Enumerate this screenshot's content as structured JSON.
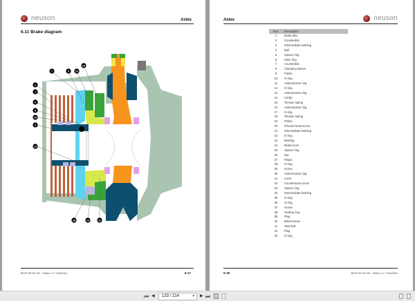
{
  "left_page": {
    "brand": "neuson",
    "header": "Axles",
    "section_title": "6.11   Brake diagram",
    "footer_text": "BETR HB 301 EN – Edition 2.2 * 503a01En",
    "page_number": "6-17",
    "callouts": {
      "top": [
        "7",
        "9",
        "10",
        "16"
      ],
      "left": [
        "2",
        "1",
        "6",
        "5",
        "15",
        "3",
        "14"
      ],
      "bottom": [
        "18",
        "13",
        "11"
      ]
    }
  },
  "right_page": {
    "brand": "neuson",
    "header": "Axles",
    "footer_text": "BETR HB 301 EN – Edition 2.2 * 503a01En",
    "page_number": "6-18",
    "table": {
      "headers": [
        "Pos.",
        "Description"
      ],
      "rows": [
        [
          "1",
          "Brake disc"
        ],
        [
          "2",
          "Counterdisc"
        ],
        [
          "3",
          "Intermediate bushing"
        ],
        [
          "4",
          "Ball"
        ],
        [
          "5",
          "Spacer ring"
        ],
        [
          "6",
          "Shim ring"
        ],
        [
          "7",
          "Counterdisc"
        ],
        [
          "8",
          "Clamping sleeve"
        ],
        [
          "9",
          "Piston"
        ],
        [
          "10",
          "O-ring"
        ],
        [
          "11",
          "Antiextrusion ring"
        ],
        [
          "12",
          "O-ring"
        ],
        [
          "13",
          "Antiextrusion ring"
        ],
        [
          "14",
          "Circlip"
        ],
        [
          "15",
          "Tension spring"
        ],
        [
          "16",
          "Antiextrusion ring"
        ],
        [
          "17",
          "O-ring"
        ],
        [
          "18",
          "Tension spring"
        ],
        [
          "19",
          "Piston"
        ],
        [
          "20",
          "Cheese-head screw"
        ],
        [
          "21",
          "Intermediate bushing"
        ],
        [
          "22",
          "O-ring"
        ],
        [
          "23",
          "Bearing"
        ],
        [
          "24",
          "Brake lever"
        ],
        [
          "25",
          "Spacer ring"
        ],
        [
          "26",
          "Nut"
        ],
        [
          "27",
          "Piston"
        ],
        [
          "28",
          "O-ring"
        ],
        [
          "29",
          "Screw"
        ],
        [
          "30",
          "Antiextrusion ring"
        ],
        [
          "31",
          "Lever"
        ],
        [
          "32",
          "Countersunk screw"
        ],
        [
          "33",
          "Spacer ring"
        ],
        [
          "34",
          "Intermediate bushing"
        ],
        [
          "35",
          "O-ring"
        ],
        [
          "36",
          "O-ring"
        ],
        [
          "37",
          "Screw"
        ],
        [
          "38",
          "Sealing ring"
        ],
        [
          "39",
          "Plug"
        ],
        [
          "40",
          "Bleed screw"
        ],
        [
          "41",
          "Stud bolt"
        ],
        [
          "42",
          "Plug"
        ],
        [
          "43",
          "O-ring"
        ]
      ]
    }
  },
  "toolbar": {
    "page_indicator": "133 / 214",
    "dropdown_arrow": "▾",
    "first": "⏮",
    "prev": "◀",
    "next": "▶",
    "last": "⏭"
  },
  "colors": {
    "housing": "#a9c5b2",
    "orange": "#f7941d",
    "navy": "#0d4f6e",
    "cyan": "#5fd3ee",
    "green": "#3aa33a",
    "lime": "#d6e84a",
    "disc": "#c0603a",
    "lilac": "#b7b4e0",
    "pink": "#e6a0e6"
  }
}
